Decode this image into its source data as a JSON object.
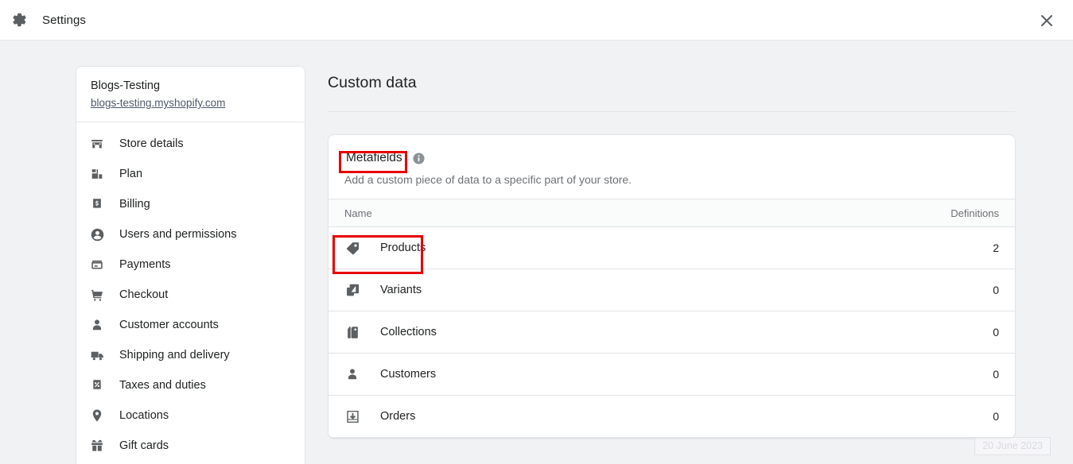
{
  "topbar": {
    "title": "Settings",
    "gear_icon": "gear-icon",
    "close_icon": "close-icon"
  },
  "sidebar": {
    "store_name": "Blogs-Testing",
    "store_url": "blogs-testing.myshopify.com",
    "items": [
      {
        "label": "Store details",
        "icon": "store-icon"
      },
      {
        "label": "Plan",
        "icon": "plan-icon"
      },
      {
        "label": "Billing",
        "icon": "billing-icon"
      },
      {
        "label": "Users and permissions",
        "icon": "user-circle-icon"
      },
      {
        "label": "Payments",
        "icon": "payments-card-icon"
      },
      {
        "label": "Checkout",
        "icon": "shopping-cart-icon"
      },
      {
        "label": "Customer accounts",
        "icon": "person-icon"
      },
      {
        "label": "Shipping and delivery",
        "icon": "truck-icon"
      },
      {
        "label": "Taxes and duties",
        "icon": "percent-receipt-icon"
      },
      {
        "label": "Locations",
        "icon": "location-pin-icon"
      },
      {
        "label": "Gift cards",
        "icon": "gift-icon"
      }
    ]
  },
  "main": {
    "page_title": "Custom data",
    "card": {
      "title": "Metafields",
      "info_icon": "info-icon",
      "description": "Add a custom piece of data to a specific part of your store.",
      "columns": {
        "name": "Name",
        "definitions": "Definitions"
      },
      "rows": [
        {
          "label": "Products",
          "icon": "tag-icon",
          "count": "2"
        },
        {
          "label": "Variants",
          "icon": "variants-icon",
          "count": "0"
        },
        {
          "label": "Collections",
          "icon": "collections-icon",
          "count": "0"
        },
        {
          "label": "Customers",
          "icon": "person-icon",
          "count": "0"
        },
        {
          "label": "Orders",
          "icon": "orders-inbox-icon",
          "count": "0"
        }
      ]
    }
  },
  "annotations": {
    "accent_color": "#e60000",
    "highlighted": [
      "Metafields",
      "Products"
    ]
  },
  "watermark": {
    "text": "20 June 2023"
  },
  "colors": {
    "page_bg": "#f1f2f4",
    "surface": "#ffffff",
    "border": "#e1e3e5",
    "text": "#202223",
    "subdued": "#6d7175",
    "icon": "#5c5f62",
    "link": "#4e5a6b"
  }
}
